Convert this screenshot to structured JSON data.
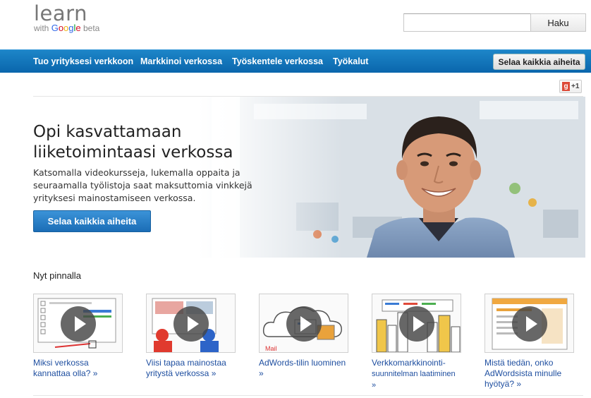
{
  "logo": {
    "learn": "learn",
    "with": "with",
    "google": "Google",
    "beta": "beta"
  },
  "search": {
    "value": "",
    "button_label": "Haku"
  },
  "nav": {
    "items": [
      {
        "label": "Tuo yrityksesi verkkoon"
      },
      {
        "label": "Markkinoi verkossa"
      },
      {
        "label": "Työskentele verkossa"
      },
      {
        "label": "Työkalut"
      }
    ],
    "browse_button": "Selaa kaikkia aiheita"
  },
  "plusone": {
    "label": "+1"
  },
  "hero": {
    "title": "Opi kasvattamaan liiketoimintaasi verkossa",
    "description": "Katsomalla videokursseja, lukemalla oppaita ja seuraamalla työlistoja saat maksuttomia vinkkejä yrityksesi mainostamiseen verkossa.",
    "button_label": "Selaa kaikkia aiheita"
  },
  "trending": {
    "title": "Nyt pinnalla",
    "cards": [
      {
        "label": "Miksi verkossa kannattaa olla? »"
      },
      {
        "label": "Viisi tapaa mainostaa yritystä verkossa »"
      },
      {
        "label": "AdWords-tilin luominen »"
      },
      {
        "label_line1": "Verkkomarkkinointi-",
        "label_line2": "suunnitelman laatiminen »"
      },
      {
        "label": "Mistä tiedän, onko AdWordsista minulle hyötyä? »"
      }
    ]
  },
  "colors": {
    "nav_bg": "#0a66ac",
    "hero_button": "#1b6db6",
    "link": "#1f4fa0"
  }
}
